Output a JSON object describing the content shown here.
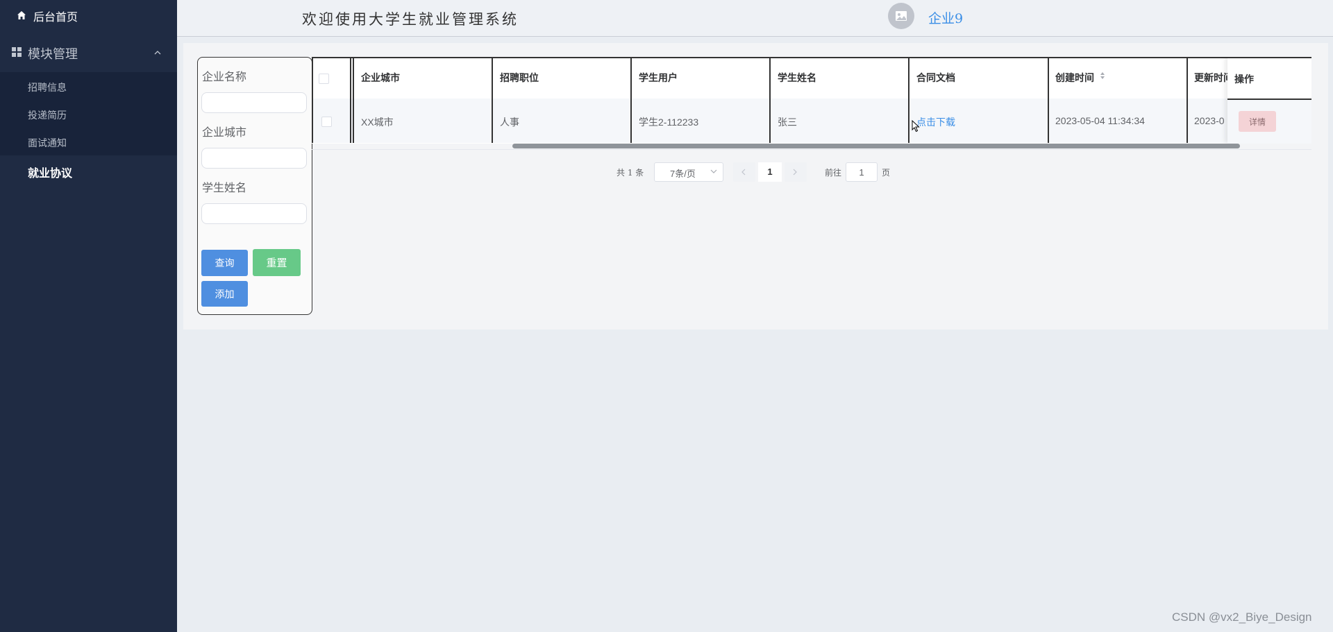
{
  "sidebar": {
    "home_label": "后台首页",
    "module_label": "模块管理",
    "sub_items": [
      {
        "label": "招聘信息"
      },
      {
        "label": "投递简历"
      },
      {
        "label": "面试通知"
      }
    ],
    "active_label": "就业协议"
  },
  "header": {
    "welcome": "欢迎使用大学生就业管理系统",
    "username": "企业9"
  },
  "search": {
    "fields": [
      {
        "label": "企业名称",
        "value": ""
      },
      {
        "label": "企业城市",
        "value": ""
      },
      {
        "label": "学生姓名",
        "value": ""
      }
    ],
    "query_label": "查询",
    "reset_label": "重置",
    "add_label": "添加"
  },
  "table": {
    "columns": [
      "企业城市",
      "招聘职位",
      "学生用户",
      "学生姓名",
      "合同文档",
      "创建时间",
      "更新时间",
      "操作"
    ],
    "rows": [
      {
        "city": "XX城市",
        "position": "人事",
        "student_user": "学生2-112233",
        "student_name": "张三",
        "contract": "点击下载",
        "created": "2023-05-04 11:34:34",
        "updated": "2023-0",
        "action": "详情"
      }
    ]
  },
  "pagination": {
    "total": "共 1 条",
    "page_size": "7条/页",
    "current_page": "1",
    "goto_label": "前往",
    "goto_value": "1",
    "unit": "页"
  },
  "watermark": "CSDN @vx2_Biye_Design",
  "colors": {
    "sidebar_bg": "#1f2b43",
    "primary": "#4f8fe0",
    "success": "#67c988",
    "link": "#3a8ee6",
    "danger_plain": "#f4d3d6"
  }
}
